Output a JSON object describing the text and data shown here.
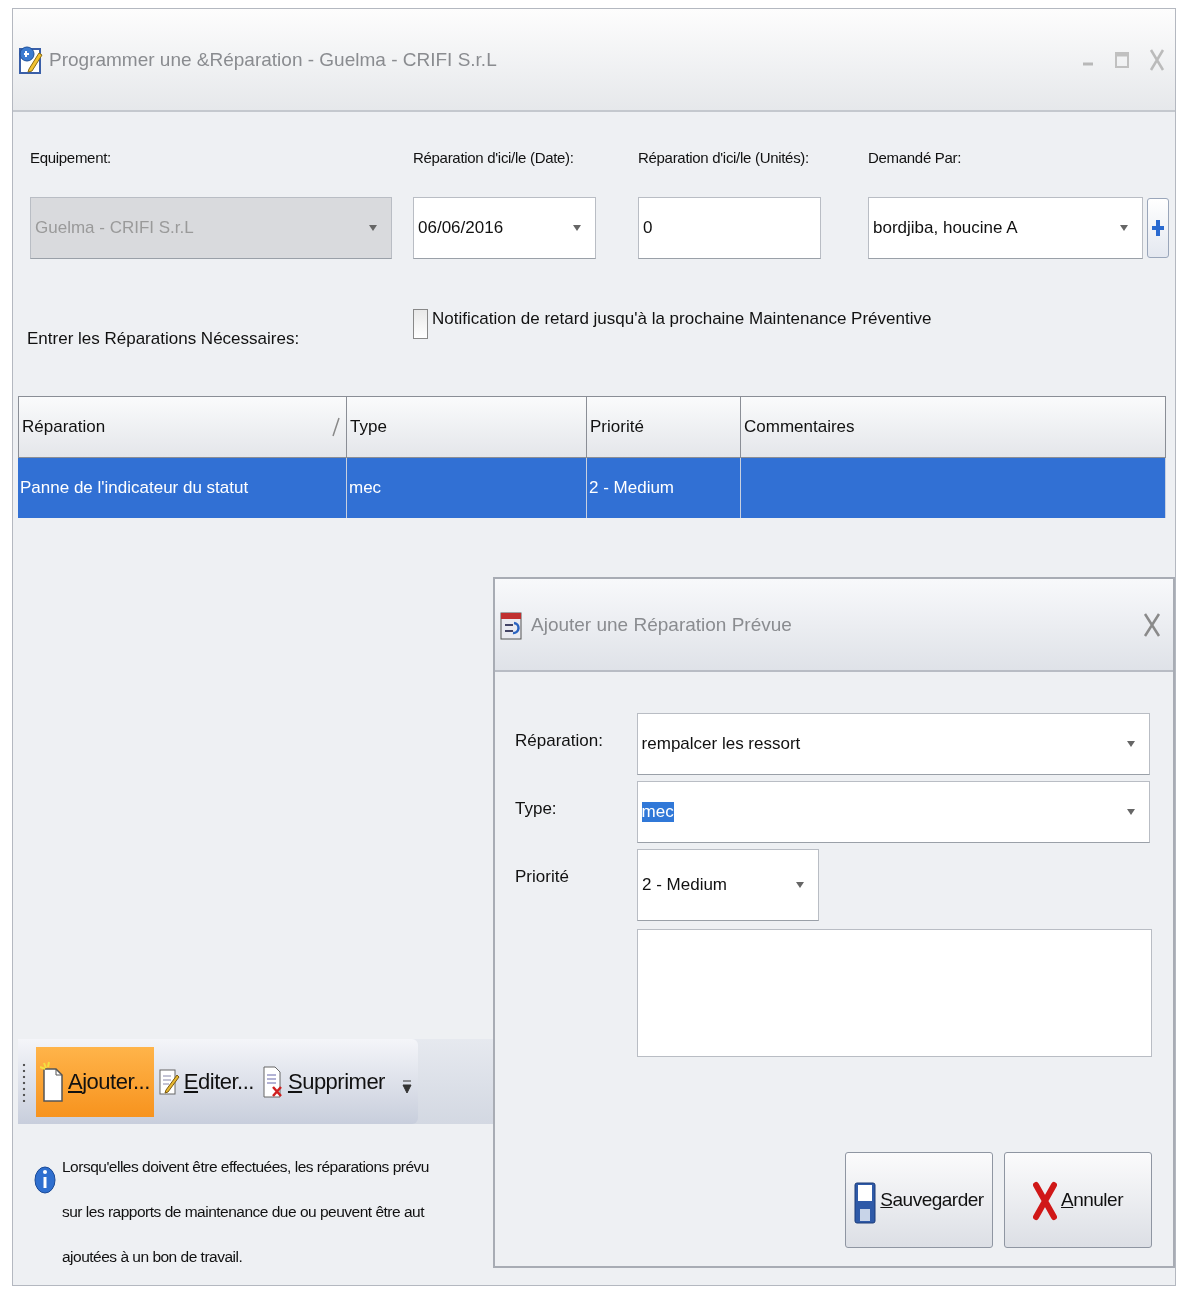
{
  "window": {
    "title": "Programmer une &Réparation - Guelma - CRIFI S.r.L"
  },
  "fields": [
    {
      "label": "Equipement:",
      "value": "Guelma - CRIFI S.r.L",
      "kind": "dropdown",
      "disabled": true
    },
    {
      "label": "Réparation d'ici/le (Date):",
      "value": "06/06/2016",
      "kind": "dropdown",
      "disabled": false
    },
    {
      "label": "Réparation d'ici/le (Unités):",
      "value": "0",
      "kind": "text",
      "disabled": false
    },
    {
      "label": "Demandé Par:",
      "value": "bordjiba, houcine A",
      "kind": "dropdown-add",
      "disabled": false
    }
  ],
  "repairs_label": "Entrer les Réparations Nécessaires:",
  "notification": {
    "label": "Notification de retard jusqu'à la prochaine Maintenance Préventive",
    "checked": false
  },
  "table": {
    "columns": [
      {
        "label": "Réparation",
        "sorted": true
      },
      {
        "label": "Type",
        "sorted": false
      },
      {
        "label": "Priorité",
        "sorted": false
      },
      {
        "label": "Commentaires",
        "sorted": false
      }
    ],
    "rows": [
      {
        "cells": [
          "Panne de l'indicateur du statut",
          "mec",
          "2 - Medium",
          ""
        ],
        "selected": true
      }
    ]
  },
  "toolbar": {
    "buttons": [
      {
        "label": "Ajouter...",
        "kind": "add",
        "highlighted": true
      },
      {
        "label": "Editer...",
        "kind": "edit",
        "highlighted": false
      },
      {
        "label": "Supprimer",
        "kind": "delete",
        "highlighted": false
      }
    ]
  },
  "info": {
    "lines": [
      "Lorsqu'elles doivent être effectuées, les réparations prévu",
      "sur les rapports de maintenance due ou peuvent être aut",
      "ajoutées à un bon de travail."
    ]
  },
  "dialog": {
    "title": "Ajouter une Réparation Prévue",
    "fields": [
      {
        "label": "Réparation:",
        "value": "rempalcer les ressort",
        "kind": "dropdown",
        "text_selected": false
      },
      {
        "label": "Type:",
        "value": "mec",
        "kind": "dropdown",
        "text_selected": true
      },
      {
        "label": "Priorité",
        "value": "2 - Medium",
        "kind": "short-dropdown",
        "text_selected": false
      },
      {
        "kind": "memo"
      }
    ],
    "buttons": [
      {
        "label": "Sauvegarder",
        "kind": "save"
      },
      {
        "label": "Annuler",
        "kind": "cancel"
      }
    ]
  }
}
